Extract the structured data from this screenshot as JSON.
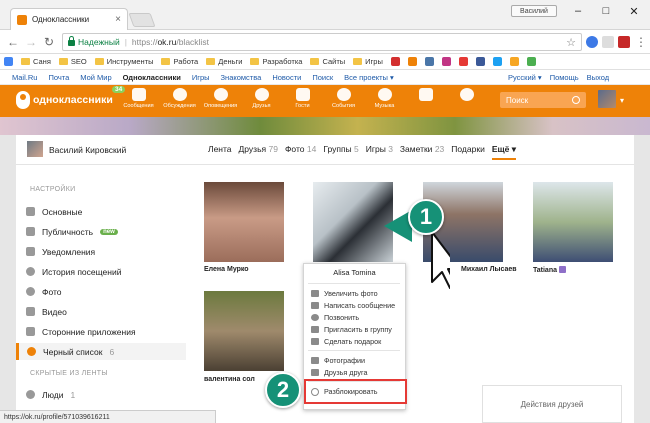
{
  "browser": {
    "tab_title": "Одноклассники",
    "profile_badge": "Василий",
    "secure_label": "Надежный",
    "url_scheme": "https://",
    "url_host": "ok.ru",
    "url_path": "/blacklist"
  },
  "bookmarks": {
    "items": [
      "Саня",
      "SEO",
      "Инструменты",
      "Работа",
      "Деньги",
      "Разработка",
      "Сайты",
      "Игры"
    ]
  },
  "portal": {
    "links": [
      "Mail.Ru",
      "Почта",
      "Мой Мир",
      "Одноклассники",
      "Игры",
      "Знакомства",
      "Новости",
      "Поиск",
      "Все проекты ▾"
    ],
    "language": "Русский ▾",
    "help": "Помощь",
    "logout": "Выход"
  },
  "ok_header": {
    "logo_text": "одноклассники",
    "badge": "34",
    "nav": [
      "Сообщения",
      "Обсуждения",
      "Оповещения",
      "Друзья",
      "Гости",
      "События",
      "Музыка",
      "",
      ""
    ],
    "search_placeholder": "Поиск"
  },
  "profile": {
    "name": "Василий Кировский",
    "tabs": [
      {
        "label": "Лента",
        "count": ""
      },
      {
        "label": "Друзья",
        "count": "79"
      },
      {
        "label": "Фото",
        "count": "14"
      },
      {
        "label": "Группы",
        "count": "5"
      },
      {
        "label": "Игры",
        "count": "3"
      },
      {
        "label": "Заметки",
        "count": "23"
      },
      {
        "label": "Подарки",
        "count": ""
      }
    ],
    "more": "Ещё ▾"
  },
  "sidebar": {
    "settings_header": "НАСТРОЙКИ",
    "items": [
      {
        "label": "Основные"
      },
      {
        "label": "Публичность"
      },
      {
        "label": "Уведомления"
      },
      {
        "label": "История посещений"
      },
      {
        "label": "Фото"
      },
      {
        "label": "Видео"
      },
      {
        "label": "Сторонние приложения"
      },
      {
        "label": "Черный список",
        "count": "6"
      }
    ],
    "new_badge": "new",
    "hidden_header": "СКРЫТЫЕ ИЗ ЛЕНТЫ",
    "hidden_item": "Люди",
    "hidden_count": "1"
  },
  "blacklist": {
    "names": [
      "Елена Мурко",
      "",
      "Михаил Лысаев",
      "Tatiana",
      "валентина сол"
    ]
  },
  "context_menu": {
    "title": "Alisa Tomina",
    "items": [
      "Увеличить фото",
      "Написать сообщение",
      "Позвонить",
      "Пригласить в группу",
      "Сделать подарок"
    ],
    "items2": [
      "Фотографии",
      "Друзья друга"
    ],
    "unblock": "Разблокировать"
  },
  "markers": {
    "one": "1",
    "two": "2"
  },
  "status_url": "https://ok.ru/profile/571039616211",
  "friends_panel": "Действия друзей",
  "colors": {
    "ok_orange": "#ee8208",
    "marker_green": "#169177",
    "highlight_red": "#e53935"
  }
}
